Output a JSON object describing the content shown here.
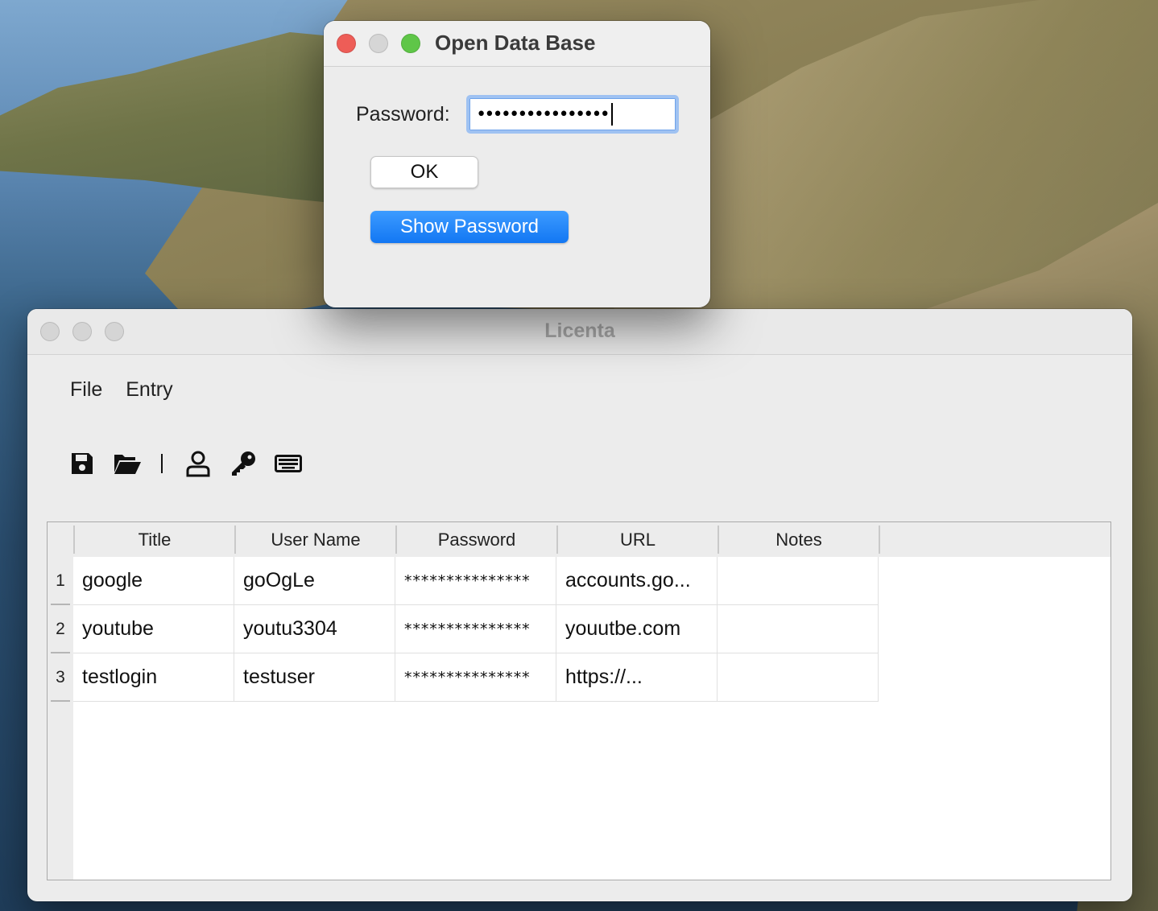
{
  "colors": {
    "close": "#ee5d57",
    "minimize": "#d6d6d6",
    "zoom": "#5fc648",
    "accent": "#1277f3"
  },
  "main_window": {
    "title": "Licenta",
    "menu": [
      "File",
      "Entry"
    ],
    "toolbar": {
      "icons": [
        "save-icon",
        "open-folder-icon",
        "separator",
        "user-icon",
        "key-icon",
        "keyboard-icon"
      ],
      "separator_text": "|"
    },
    "table": {
      "columns": [
        "Title",
        "User Name",
        "Password",
        "URL",
        "Notes"
      ],
      "rows": [
        {
          "num": "1",
          "title": "google",
          "username": "goOgLe",
          "password": "***************",
          "url": "accounts.go...",
          "notes": ""
        },
        {
          "num": "2",
          "title": "youtube",
          "username": "youtu3304",
          "password": "***************",
          "url": "youutbe.com",
          "notes": ""
        },
        {
          "num": "3",
          "title": "testlogin",
          "username": "testuser",
          "password": "***************",
          "url": "https://...",
          "notes": ""
        }
      ]
    }
  },
  "dialog": {
    "title": "Open Data Base",
    "password_label": "Password:",
    "password_value": "••••••••••••••••",
    "ok_label": "OK",
    "show_password_label": "Show Password"
  }
}
